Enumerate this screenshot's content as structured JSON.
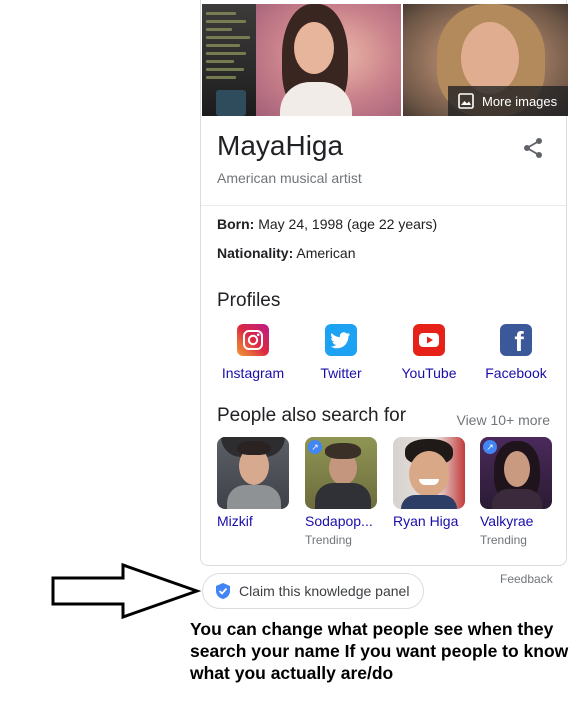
{
  "panel": {
    "more_images_label": "More images",
    "title": "MayaHiga",
    "subtitle": "American musical artist",
    "facts": [
      {
        "label": "Born:",
        "value": " May 24, 1998 (age 22 years)"
      },
      {
        "label": "Nationality:",
        "value": " American"
      }
    ],
    "profiles_heading": "Profiles",
    "profiles": [
      {
        "label": "Instagram",
        "icon": "instagram-icon",
        "color": "#d6249f"
      },
      {
        "label": "Twitter",
        "icon": "twitter-icon",
        "color": "#1da1f2"
      },
      {
        "label": "YouTube",
        "icon": "youtube-icon",
        "color": "#e62117"
      },
      {
        "label": "Facebook",
        "icon": "facebook-icon",
        "color": "#3b5998"
      }
    ],
    "people_heading": "People also search for",
    "view_more_label": "View 10+ more",
    "people": [
      {
        "name": "Mizkif",
        "note": ""
      },
      {
        "name": "Sodapop...",
        "note": "Trending"
      },
      {
        "name": "Ryan Higa",
        "note": ""
      },
      {
        "name": "Valkyrae",
        "note": "Trending"
      }
    ],
    "feedback_label": "Feedback",
    "claim_label": "Claim this knowledge panel"
  },
  "annotation": {
    "text": "You can change what people see when they search your name If you want people to know what you actually are/do"
  },
  "colors": {
    "link": "#1a0dab",
    "secondary_text": "#70757a",
    "verified_badge": "#4285f4"
  }
}
